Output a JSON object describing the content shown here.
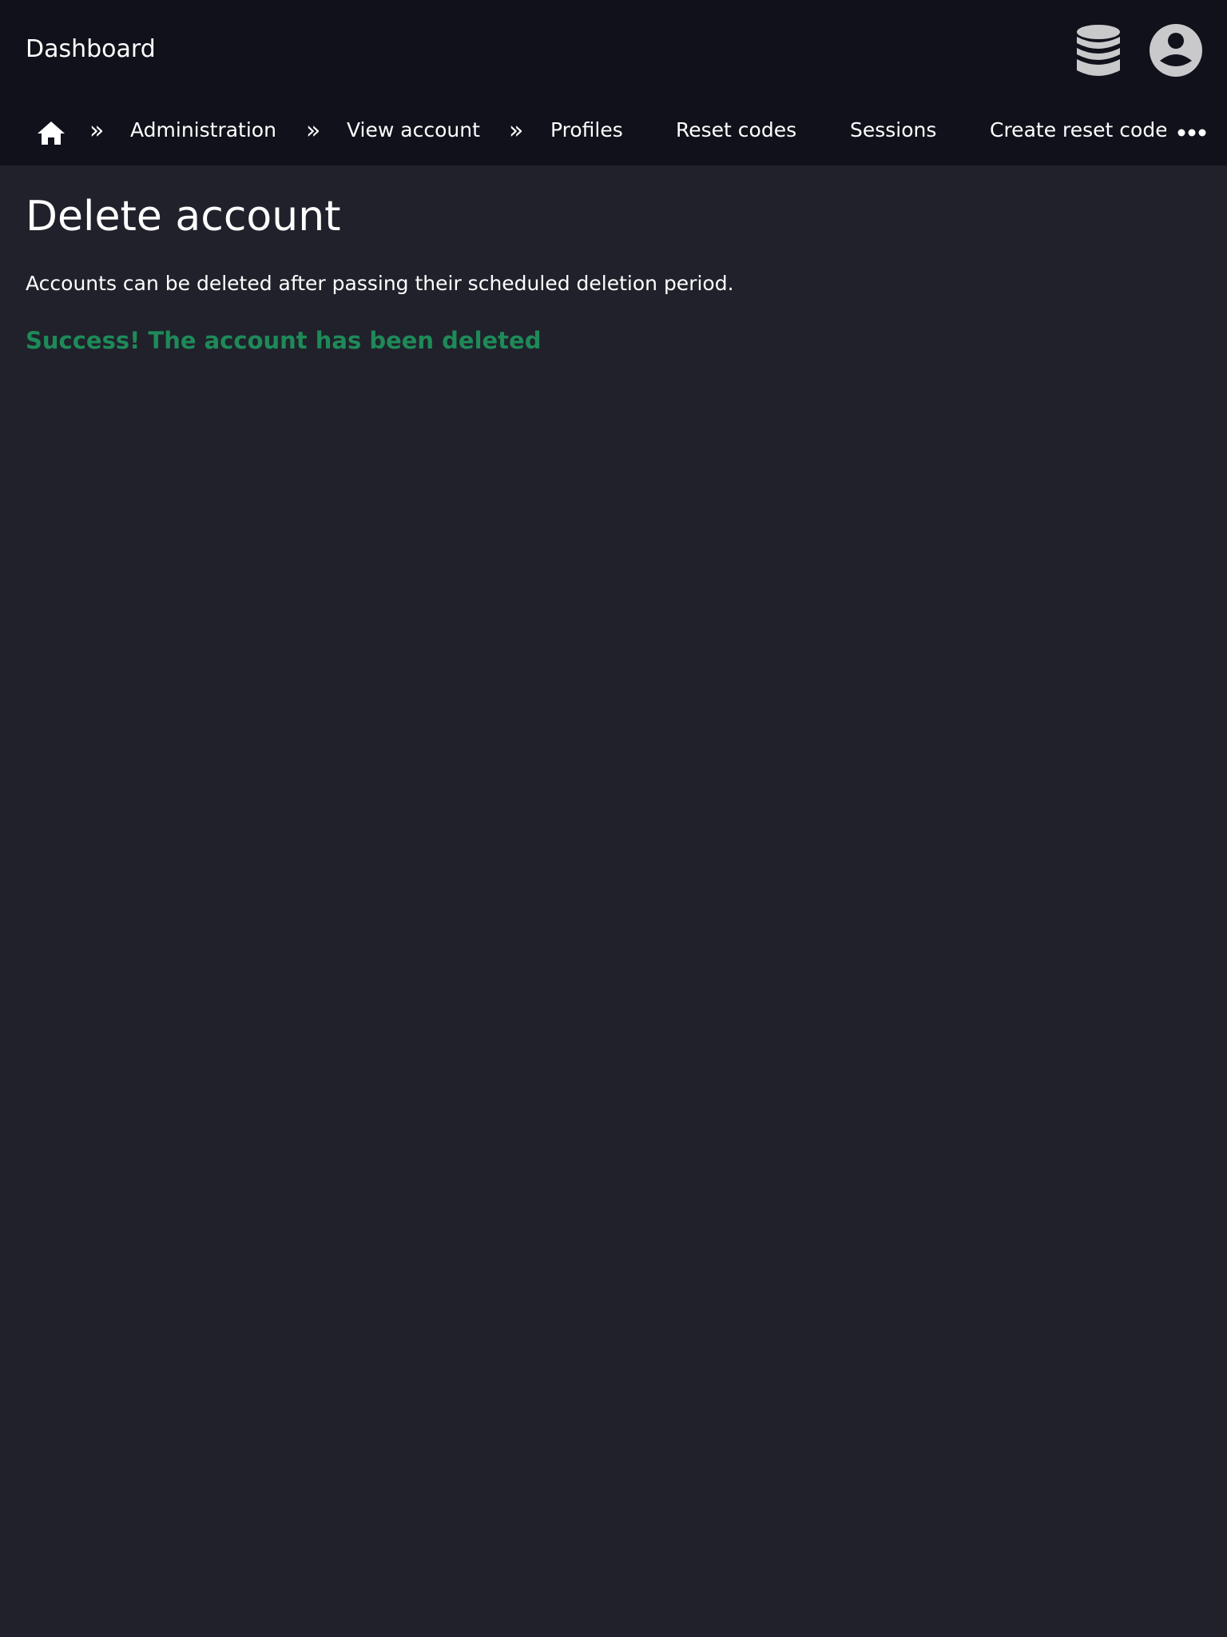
{
  "header": {
    "title": "Dashboard",
    "db_icon": "database-icon",
    "user_icon": "user-circle-icon",
    "background": "#10111b"
  },
  "nav": {
    "home_icon": "home-icon",
    "separator": "»",
    "breadcrumbs": [
      {
        "label": "Administration"
      },
      {
        "label": "View account"
      }
    ],
    "tabs": [
      {
        "label": "Profiles"
      },
      {
        "label": "Reset codes"
      },
      {
        "label": "Sessions"
      },
      {
        "label": "Create reset code"
      }
    ],
    "more_icon": "more-horizontal-icon"
  },
  "main": {
    "title": "Delete account",
    "description": "Accounts can be deleted after passing their scheduled deletion period.",
    "success_message": "Success! The account has been deleted",
    "success_color": "#1e8a58",
    "background": "#20212b"
  }
}
